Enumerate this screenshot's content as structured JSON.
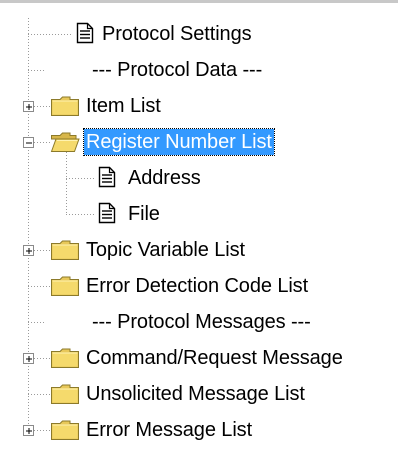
{
  "tree": {
    "items": [
      {
        "label": "Protocol Settings",
        "type": "document"
      },
      {
        "label": "--- Protocol Data ---",
        "type": "separator"
      },
      {
        "label": "Item List",
        "type": "folder",
        "expander": "+"
      },
      {
        "label": "Register Number List",
        "type": "open-folder",
        "expander": "-",
        "selected": true
      },
      {
        "label": "Address",
        "type": "document"
      },
      {
        "label": "File",
        "type": "document"
      },
      {
        "label": "Topic Variable List",
        "type": "folder",
        "expander": "+"
      },
      {
        "label": "Error Detection Code List",
        "type": "folder"
      },
      {
        "label": "--- Protocol Messages ---",
        "type": "separator"
      },
      {
        "label": "Command/Request Message",
        "type": "folder",
        "expander": "+"
      },
      {
        "label": "Unsolicited Message List",
        "type": "folder"
      },
      {
        "label": "Error Message List",
        "type": "folder",
        "expander": "+"
      }
    ]
  }
}
